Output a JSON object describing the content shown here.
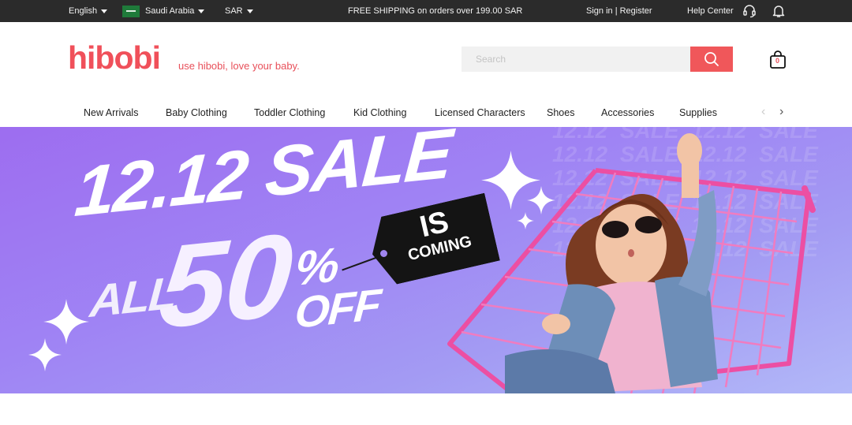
{
  "topbar": {
    "language": "English",
    "country": "Saudi Arabia",
    "currency": "SAR",
    "shipping_notice": "FREE SHIPPING on orders over 199.00 SAR",
    "sign_in": "Sign in | Register",
    "help_center": "Help Center",
    "icons": [
      "headset-icon",
      "bell-icon"
    ]
  },
  "header": {
    "logo": "hibobi",
    "slogan": "use hibobi, love your baby.",
    "search_placeholder": "Search",
    "cart_count": "0",
    "icons": [
      "search-icon",
      "shopping-bag-icon"
    ]
  },
  "nav": {
    "items": [
      "New Arrivals",
      "Baby Clothing",
      "Toddler Clothing",
      "Kid Clothing",
      "Licensed Characters",
      "Shoes",
      "Accessories",
      "Supplies"
    ],
    "prev_arrow": "‹",
    "next_arrow": "›"
  },
  "banner": {
    "headline": "12.12 SALE",
    "all": "ALL",
    "fifty": "50",
    "percent": "%",
    "off": "OFF",
    "tag_line_1": "IS",
    "tag_line_2": "COMING",
    "background_text": "12.12 SALE 12.12 SALE 12.12 SALE 12.12 SALE 12.12 SALE 12.12 SALE 12.12 SALE 12.12 SALE 12.12 SALE 12.12 SALE 12.12 SALE 12.12 SALE",
    "colors": {
      "gradient_start": "#9d6df0",
      "gradient_end": "#b2b8f8",
      "cart_pink": "#ec4fa3"
    }
  },
  "colors": {
    "brand": "#f0505a",
    "topbar": "#2b2b2b",
    "search_button": "#f0575a"
  }
}
